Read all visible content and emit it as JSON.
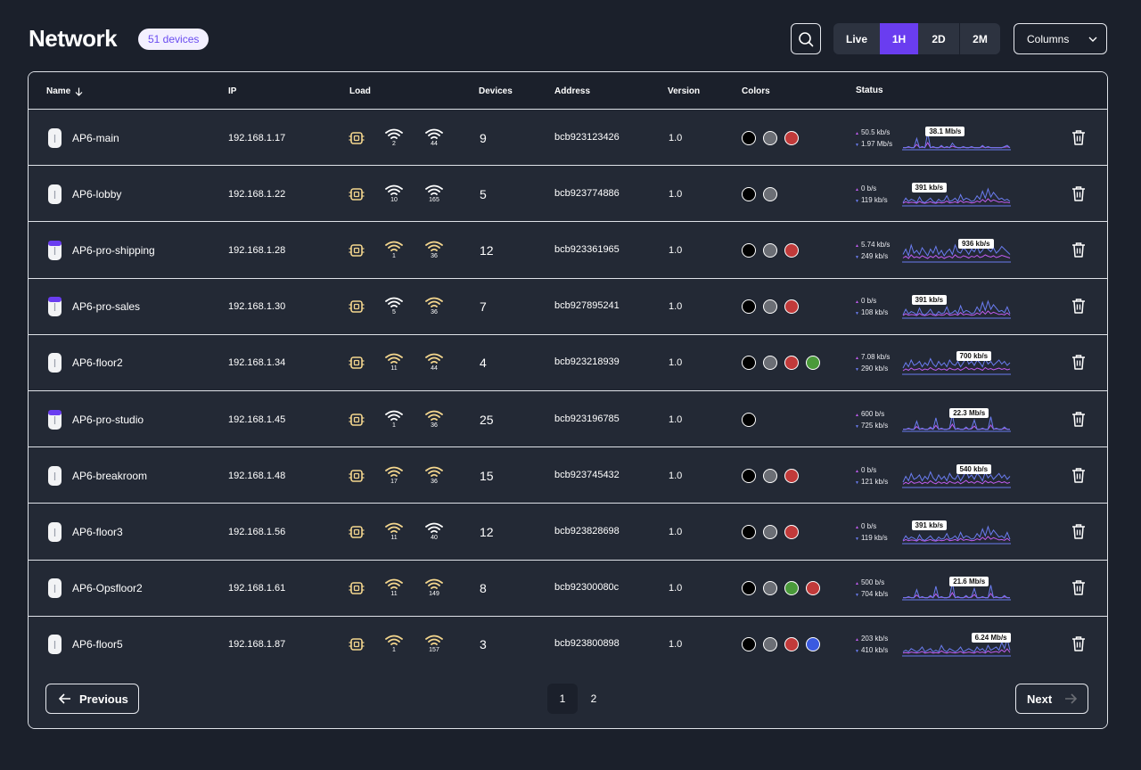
{
  "header": {
    "title": "Network",
    "badge": "51 devices",
    "ranges": [
      "Live",
      "1H",
      "2D",
      "2M"
    ],
    "active_range": "1H",
    "columns_label": "Columns"
  },
  "table": {
    "columns": [
      "Name",
      "IP",
      "Load",
      "Devices",
      "Address",
      "Version",
      "Colors",
      "Status"
    ],
    "rows": [
      {
        "name": "AP6-main",
        "pro": false,
        "ip": "192.168.1.17",
        "wifi_a": "2",
        "wifi_a_color": "#ffffff",
        "wifi_b": "44",
        "wifi_b_color": "#ffffff",
        "devices": "9",
        "address": "bcb923123426",
        "version": "1.0",
        "colors": [
          "#000000",
          "#6b6e75",
          "#c13a3a"
        ],
        "up": "50.5 kb/s",
        "down": "1.97 Mb/s",
        "tag": "38.1 Mb/s",
        "tag_pos": 0.38,
        "spark": [
          1,
          1,
          2,
          1,
          1,
          9,
          1,
          2,
          1,
          14,
          1,
          2,
          1,
          1,
          3,
          1,
          2,
          1,
          5,
          2,
          1,
          1,
          2,
          1,
          1,
          2,
          1,
          1,
          1,
          3,
          1,
          2,
          1,
          1,
          1,
          1,
          1,
          2,
          3,
          1
        ]
      },
      {
        "name": "AP6-lobby",
        "pro": false,
        "ip": "192.168.1.22",
        "wifi_a": "10",
        "wifi_a_color": "#ffffff",
        "wifi_b": "165",
        "wifi_b_color": "#ffffff",
        "devices": "5",
        "address": "bcb923774886",
        "version": "1.0",
        "colors": [
          "#000000",
          "#6b6e75"
        ],
        "up": "0 b/s",
        "down": "119 kb/s",
        "tag": "391 kb/s",
        "tag_pos": 0.25,
        "spark": [
          2,
          6,
          3,
          5,
          4,
          2,
          7,
          3,
          2,
          4,
          6,
          3,
          2,
          5,
          3,
          4,
          8,
          3,
          4,
          6,
          3,
          9,
          4,
          6,
          5,
          3,
          4,
          8,
          5,
          12,
          6,
          14,
          7,
          11,
          8,
          5,
          6,
          4,
          5,
          3
        ]
      },
      {
        "name": "AP6-pro-shipping",
        "pro": true,
        "ip": "192.168.1.28",
        "wifi_a": "1",
        "wifi_a_color": "#f5d78e",
        "wifi_b": "36",
        "wifi_b_color": "#f5d78e",
        "devices": "12",
        "address": "bcb923361965",
        "version": "1.0",
        "colors": [
          "#000000",
          "#6b6e75",
          "#c13a3a"
        ],
        "up": "5.74 kb/s",
        "down": "249 kb/s",
        "tag": "936 kb/s",
        "tag_pos": 0.68,
        "spark": [
          5,
          9,
          4,
          12,
          6,
          8,
          5,
          10,
          7,
          4,
          9,
          6,
          11,
          5,
          8,
          4,
          7,
          9,
          5,
          12,
          7,
          6,
          10,
          8,
          5,
          9,
          7,
          11,
          6,
          8,
          12,
          9,
          7,
          10,
          6,
          8,
          11,
          9,
          7,
          5
        ]
      },
      {
        "name": "AP6-pro-sales",
        "pro": true,
        "ip": "192.168.1.30",
        "wifi_a": "5",
        "wifi_a_color": "#ffffff",
        "wifi_b": "36",
        "wifi_b_color": "#f5d78e",
        "devices": "7",
        "address": "bcb927895241",
        "version": "1.0",
        "colors": [
          "#000000",
          "#6b6e75",
          "#c13a3a"
        ],
        "up": "0 b/s",
        "down": "108 kb/s",
        "tag": "391 kb/s",
        "tag_pos": 0.25,
        "spark": [
          2,
          7,
          3,
          5,
          4,
          2,
          8,
          3,
          2,
          4,
          7,
          3,
          2,
          5,
          3,
          4,
          9,
          3,
          4,
          6,
          3,
          10,
          4,
          6,
          5,
          3,
          4,
          9,
          5,
          13,
          6,
          14,
          7,
          11,
          8,
          5,
          6,
          4,
          9,
          3
        ]
      },
      {
        "name": "AP6-floor2",
        "pro": false,
        "ip": "192.168.1.34",
        "wifi_a": "11",
        "wifi_a_color": "#f5d78e",
        "wifi_b": "44",
        "wifi_b_color": "#f5d78e",
        "devices": "4",
        "address": "bcb923218939",
        "version": "1.0",
        "colors": [
          "#000000",
          "#6b6e75",
          "#c13a3a",
          "#4a9a3a"
        ],
        "up": "7.08 kb/s",
        "down": "290 kb/s",
        "tag": "700 kb/s",
        "tag_pos": 0.66,
        "spark": [
          4,
          8,
          5,
          10,
          6,
          7,
          9,
          5,
          8,
          6,
          11,
          7,
          5,
          9,
          6,
          8,
          5,
          10,
          7,
          6,
          9,
          5,
          8,
          12,
          7,
          9,
          6,
          10,
          8,
          5,
          11,
          7,
          9,
          6,
          8,
          10,
          7,
          9,
          6,
          8
        ]
      },
      {
        "name": "AP6-pro-studio",
        "pro": true,
        "ip": "192.168.1.45",
        "wifi_a": "1",
        "wifi_a_color": "#ffffff",
        "wifi_b": "36",
        "wifi_b_color": "#f5d78e",
        "devices": "25",
        "address": "bcb923196785",
        "version": "1.0",
        "colors": [
          "#000000"
        ],
        "up": "600 b/s",
        "down": "725 kb/s",
        "tag": "22.3 Mb/s",
        "tag_pos": 0.6,
        "spark": [
          1,
          1,
          2,
          1,
          1,
          8,
          1,
          2,
          1,
          1,
          3,
          1,
          11,
          1,
          2,
          1,
          1,
          2,
          14,
          1,
          2,
          1,
          1,
          3,
          1,
          2,
          9,
          1,
          1,
          2,
          1,
          1,
          12,
          1,
          2,
          1,
          1,
          3,
          1,
          1
        ]
      },
      {
        "name": "AP6-breakroom",
        "pro": false,
        "ip": "192.168.1.48",
        "wifi_a": "17",
        "wifi_a_color": "#f5d78e",
        "wifi_b": "36",
        "wifi_b_color": "#f5d78e",
        "devices": "15",
        "address": "bcb923745432",
        "version": "1.0",
        "colors": [
          "#000000",
          "#6b6e75",
          "#c13a3a"
        ],
        "up": "0 b/s",
        "down": "121 kb/s",
        "tag": "540 kb/s",
        "tag_pos": 0.66,
        "spark": [
          3,
          7,
          4,
          9,
          5,
          6,
          8,
          4,
          7,
          5,
          10,
          6,
          4,
          8,
          5,
          7,
          4,
          9,
          6,
          5,
          8,
          4,
          7,
          11,
          6,
          8,
          5,
          9,
          7,
          4,
          10,
          6,
          8,
          5,
          7,
          9,
          6,
          8,
          5,
          7
        ]
      },
      {
        "name": "AP6-floor3",
        "pro": false,
        "ip": "192.168.1.56",
        "wifi_a": "11",
        "wifi_a_color": "#f5d78e",
        "wifi_b": "40",
        "wifi_b_color": "#ffffff",
        "devices": "12",
        "address": "bcb923828698",
        "version": "1.0",
        "colors": [
          "#000000",
          "#6b6e75",
          "#c13a3a"
        ],
        "up": "0 b/s",
        "down": "119 kb/s",
        "tag": "391 kb/s",
        "tag_pos": 0.25,
        "spark": [
          2,
          6,
          3,
          5,
          4,
          2,
          7,
          3,
          2,
          4,
          6,
          3,
          2,
          5,
          3,
          4,
          8,
          3,
          4,
          6,
          3,
          9,
          4,
          6,
          5,
          3,
          4,
          8,
          5,
          12,
          6,
          14,
          7,
          11,
          8,
          5,
          6,
          4,
          9,
          3
        ]
      },
      {
        "name": "AP6-Opsfloor2",
        "pro": false,
        "ip": "192.168.1.61",
        "wifi_a": "11",
        "wifi_a_color": "#f5d78e",
        "wifi_b": "149",
        "wifi_b_color": "#f5d78e",
        "devices": "8",
        "address": "bcb92300080c",
        "version": "1.0",
        "colors": [
          "#000000",
          "#6b6e75",
          "#4a9a3a",
          "#c13a3a"
        ],
        "up": "500 b/s",
        "down": "704 kb/s",
        "tag": "21.6 Mb/s",
        "tag_pos": 0.6,
        "spark": [
          1,
          1,
          2,
          1,
          1,
          8,
          1,
          2,
          1,
          1,
          3,
          1,
          11,
          1,
          2,
          1,
          1,
          2,
          14,
          1,
          2,
          1,
          1,
          3,
          1,
          2,
          9,
          1,
          1,
          2,
          1,
          1,
          12,
          1,
          2,
          1,
          1,
          3,
          1,
          1
        ]
      },
      {
        "name": "AP6-floor5",
        "pro": false,
        "ip": "192.168.1.87",
        "wifi_a": "1",
        "wifi_a_color": "#f5d78e",
        "wifi_b": "157",
        "wifi_b_color": "#f5d78e",
        "devices": "3",
        "address": "bcb923800898",
        "version": "1.0",
        "colors": [
          "#000000",
          "#6b6e75",
          "#c13a3a",
          "#3a5ae0"
        ],
        "up": "203 kb/s",
        "down": "410 kb/s",
        "tag": "6.24 Mb/s",
        "tag_pos": 0.8,
        "spark": [
          2,
          3,
          2,
          4,
          3,
          2,
          3,
          5,
          2,
          3,
          4,
          2,
          3,
          2,
          6,
          3,
          2,
          4,
          3,
          2,
          3,
          5,
          2,
          3,
          4,
          3,
          2,
          5,
          3,
          4,
          2,
          6,
          3,
          4,
          5,
          3,
          8,
          4,
          10,
          3
        ]
      }
    ]
  },
  "pagination": {
    "previous": "Previous",
    "next": "Next",
    "pages": [
      "1",
      "2"
    ],
    "current": "1"
  },
  "colors": {
    "accent": "#6a3df0",
    "load_icon": "#f5d78e",
    "spark_down": "#6a7cf0",
    "spark_up": "#c05cf0"
  }
}
